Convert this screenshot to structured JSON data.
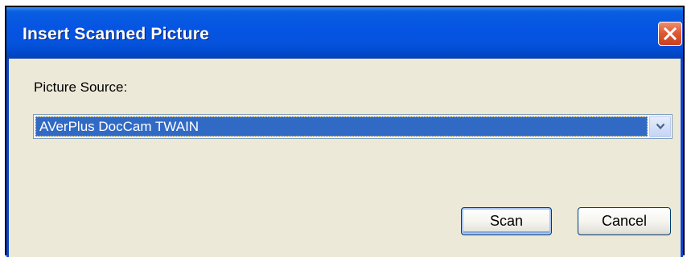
{
  "window": {
    "title": "Insert Scanned Picture",
    "close_icon": "close-x-icon",
    "close_color": "#e05a36",
    "titlebar_color": "#0554e3"
  },
  "form": {
    "source_label": "Picture Source:",
    "source_value": "AVerPlus DocCam TWAIN",
    "dropdown_icon": "chevron-down-icon",
    "selection_color": "#316ac5"
  },
  "buttons": {
    "scan_label": "Scan",
    "cancel_label": "Cancel"
  }
}
